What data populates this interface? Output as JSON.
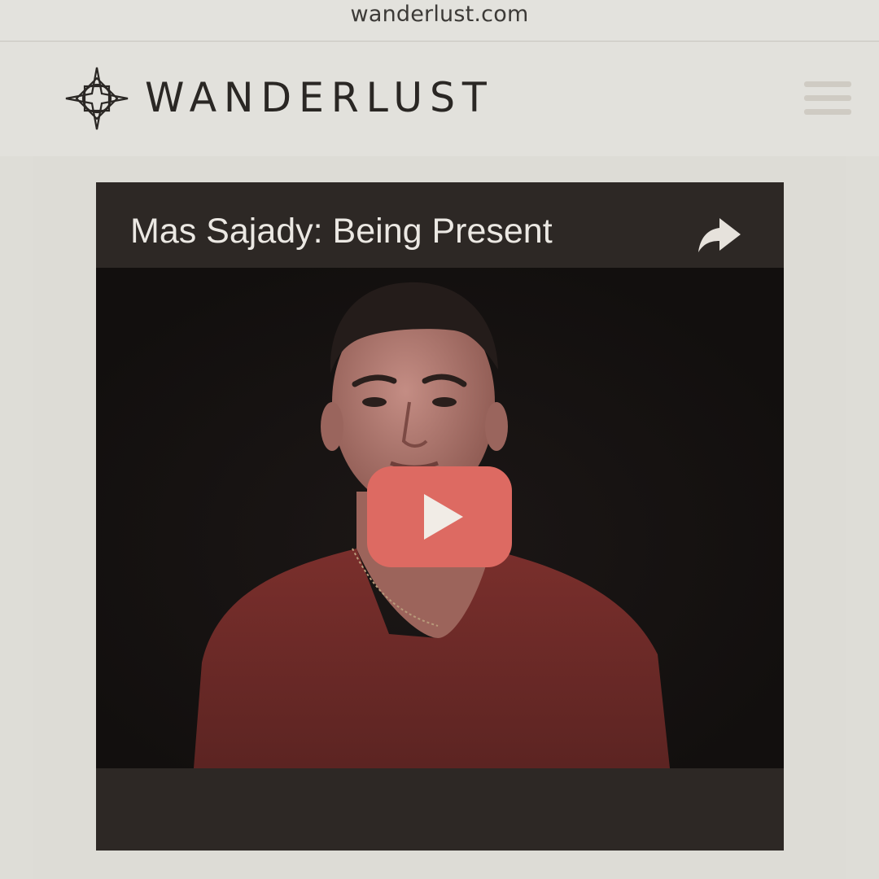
{
  "browser": {
    "url": "wanderlust.com"
  },
  "header": {
    "brand": "WANDERLUST",
    "logo_icon": "compass-star-icon",
    "menu_icon": "hamburger-menu-icon"
  },
  "video": {
    "title": "Mas Sajady: Being Present",
    "share_icon": "share-arrow-icon",
    "play_icon": "youtube-play-icon",
    "play_color": "#dd6a62",
    "background_color": "#2d2825"
  },
  "colors": {
    "page_background": "#deddd7",
    "header_background": "#e2e1dc",
    "brand_text": "#2a2724",
    "menu_icon": "#cfcbc3"
  }
}
